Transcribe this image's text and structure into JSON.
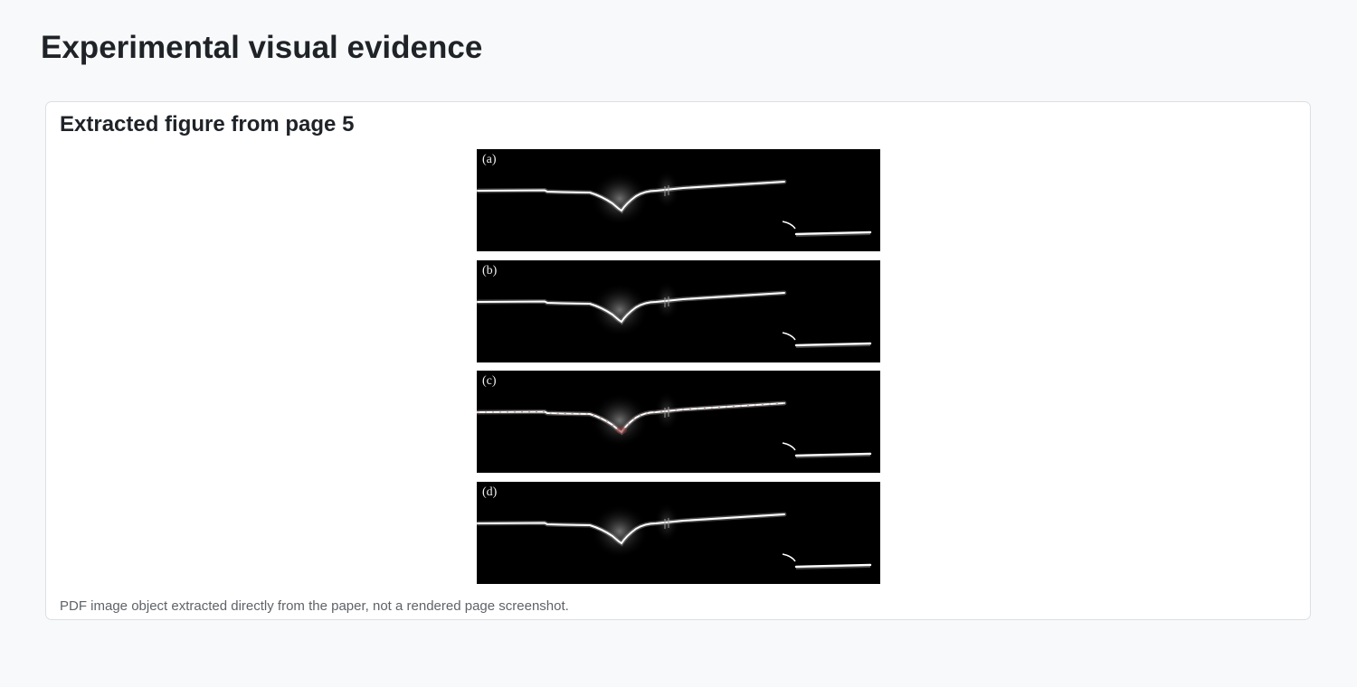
{
  "page": {
    "title": "Experimental visual evidence"
  },
  "card": {
    "title": "Extracted figure from page 5",
    "caption": "PDF image object extracted directly from the paper, not a rendered page screenshot."
  },
  "figure": {
    "panels": [
      {
        "label": "(a)"
      },
      {
        "label": "(b)"
      },
      {
        "label": "(c)"
      },
      {
        "label": "(d)"
      }
    ]
  }
}
